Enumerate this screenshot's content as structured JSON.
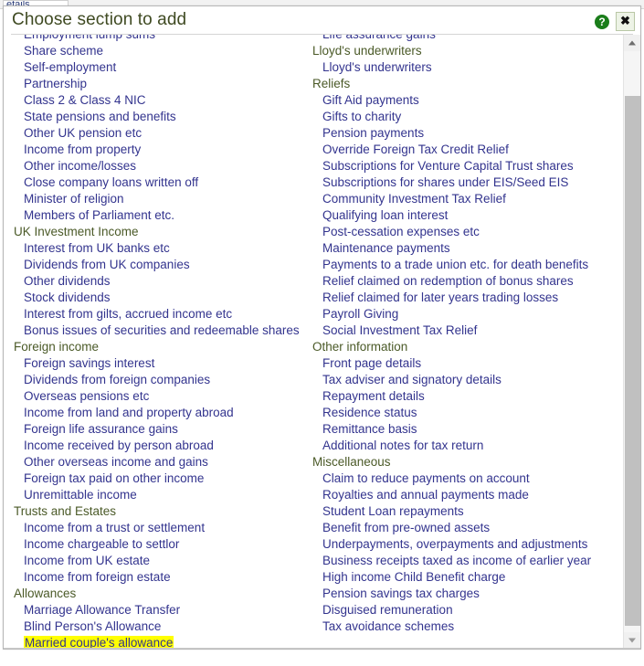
{
  "app": {
    "tab_label": "etails"
  },
  "dialog": {
    "title": "Choose section to add",
    "help_icon": "question-mark-icon",
    "close_icon": "close-x-icon",
    "help_label": "?",
    "close_label": "✖",
    "accent_title_color": "#3f4a22",
    "group_color": "#4b5a28",
    "item_color": "#33348e",
    "highlight_color": "#ffff00"
  },
  "scrollbar": {
    "up_label": "scroll-up",
    "down_label": "scroll-down"
  },
  "columns": {
    "left": [
      {
        "type": "item",
        "label": "Employment lump sums"
      },
      {
        "type": "item",
        "label": "Share scheme"
      },
      {
        "type": "item",
        "label": "Self-employment"
      },
      {
        "type": "item",
        "label": "Partnership"
      },
      {
        "type": "item",
        "label": "Class 2 & Class 4 NIC"
      },
      {
        "type": "item",
        "label": "State pensions and benefits"
      },
      {
        "type": "item",
        "label": "Other UK pension etc"
      },
      {
        "type": "item",
        "label": "Income from property"
      },
      {
        "type": "item",
        "label": "Other income/losses"
      },
      {
        "type": "item",
        "label": "Close company loans written off"
      },
      {
        "type": "item",
        "label": "Minister of religion"
      },
      {
        "type": "item",
        "label": "Members of Parliament etc."
      },
      {
        "type": "group",
        "label": "UK Investment Income"
      },
      {
        "type": "item",
        "label": "Interest from UK banks etc"
      },
      {
        "type": "item",
        "label": "Dividends from UK companies"
      },
      {
        "type": "item",
        "label": "Other dividends"
      },
      {
        "type": "item",
        "label": "Stock dividends"
      },
      {
        "type": "item",
        "label": "Interest from gilts, accrued income etc"
      },
      {
        "type": "item",
        "label": "Bonus issues of securities and redeemable shares"
      },
      {
        "type": "group",
        "label": "Foreign income"
      },
      {
        "type": "item",
        "label": "Foreign savings interest"
      },
      {
        "type": "item",
        "label": "Dividends from foreign companies"
      },
      {
        "type": "item",
        "label": "Overseas pensions etc"
      },
      {
        "type": "item",
        "label": "Income from land and property abroad"
      },
      {
        "type": "item",
        "label": "Foreign life assurance gains"
      },
      {
        "type": "item",
        "label": "Income received by person abroad"
      },
      {
        "type": "item",
        "label": "Other overseas income and gains"
      },
      {
        "type": "item",
        "label": "Foreign tax paid on other income"
      },
      {
        "type": "item",
        "label": "Unremittable income"
      },
      {
        "type": "group",
        "label": "Trusts and Estates"
      },
      {
        "type": "item",
        "label": "Income from a trust or settlement"
      },
      {
        "type": "item",
        "label": "Income chargeable to settlor"
      },
      {
        "type": "item",
        "label": "Income from UK estate"
      },
      {
        "type": "item",
        "label": "Income from foreign estate"
      },
      {
        "type": "group",
        "label": "Allowances"
      },
      {
        "type": "item",
        "label": "Marriage Allowance Transfer"
      },
      {
        "type": "item",
        "label": "Blind Person's Allowance"
      },
      {
        "type": "item",
        "label": "Married couple's allowance",
        "highlighted": true
      }
    ],
    "right": [
      {
        "type": "item",
        "label": "Life assurance gains"
      },
      {
        "type": "group",
        "label": "Lloyd's underwriters"
      },
      {
        "type": "item",
        "label": "Lloyd's underwriters"
      },
      {
        "type": "group",
        "label": "Reliefs"
      },
      {
        "type": "item",
        "label": "Gift Aid payments"
      },
      {
        "type": "item",
        "label": "Gifts to charity"
      },
      {
        "type": "item",
        "label": "Pension payments"
      },
      {
        "type": "item",
        "label": "Override Foreign Tax Credit Relief"
      },
      {
        "type": "item",
        "label": "Subscriptions for Venture Capital Trust shares"
      },
      {
        "type": "item",
        "label": "Subscriptions for shares under EIS/Seed EIS"
      },
      {
        "type": "item",
        "label": "Community Investment Tax Relief"
      },
      {
        "type": "item",
        "label": "Qualifying loan interest"
      },
      {
        "type": "item",
        "label": "Post-cessation expenses etc"
      },
      {
        "type": "item",
        "label": "Maintenance payments"
      },
      {
        "type": "item",
        "label": "Payments to a trade union etc. for death benefits"
      },
      {
        "type": "item",
        "label": "Relief claimed on redemption of bonus shares"
      },
      {
        "type": "item",
        "label": "Relief claimed for later years trading losses"
      },
      {
        "type": "item",
        "label": "Payroll Giving"
      },
      {
        "type": "item",
        "label": "Social Investment Tax Relief"
      },
      {
        "type": "group",
        "label": "Other information"
      },
      {
        "type": "item",
        "label": "Front page details"
      },
      {
        "type": "item",
        "label": "Tax adviser and signatory details"
      },
      {
        "type": "item",
        "label": "Repayment details"
      },
      {
        "type": "item",
        "label": "Residence status"
      },
      {
        "type": "item",
        "label": "Remittance basis"
      },
      {
        "type": "item",
        "label": "Additional notes for tax return"
      },
      {
        "type": "group",
        "label": "Miscellaneous"
      },
      {
        "type": "item",
        "label": "Claim to reduce payments on account"
      },
      {
        "type": "item",
        "label": "Royalties and annual payments made"
      },
      {
        "type": "item",
        "label": "Student Loan repayments"
      },
      {
        "type": "item",
        "label": "Benefit from pre-owned assets"
      },
      {
        "type": "item",
        "label": "Underpayments, overpayments and adjustments"
      },
      {
        "type": "item",
        "label": "Business receipts taxed as income of earlier year"
      },
      {
        "type": "item",
        "label": "High income Child Benefit charge"
      },
      {
        "type": "item",
        "label": "Pension savings tax charges"
      },
      {
        "type": "item",
        "label": "Disguised remuneration"
      },
      {
        "type": "item",
        "label": "Tax avoidance schemes"
      }
    ]
  }
}
